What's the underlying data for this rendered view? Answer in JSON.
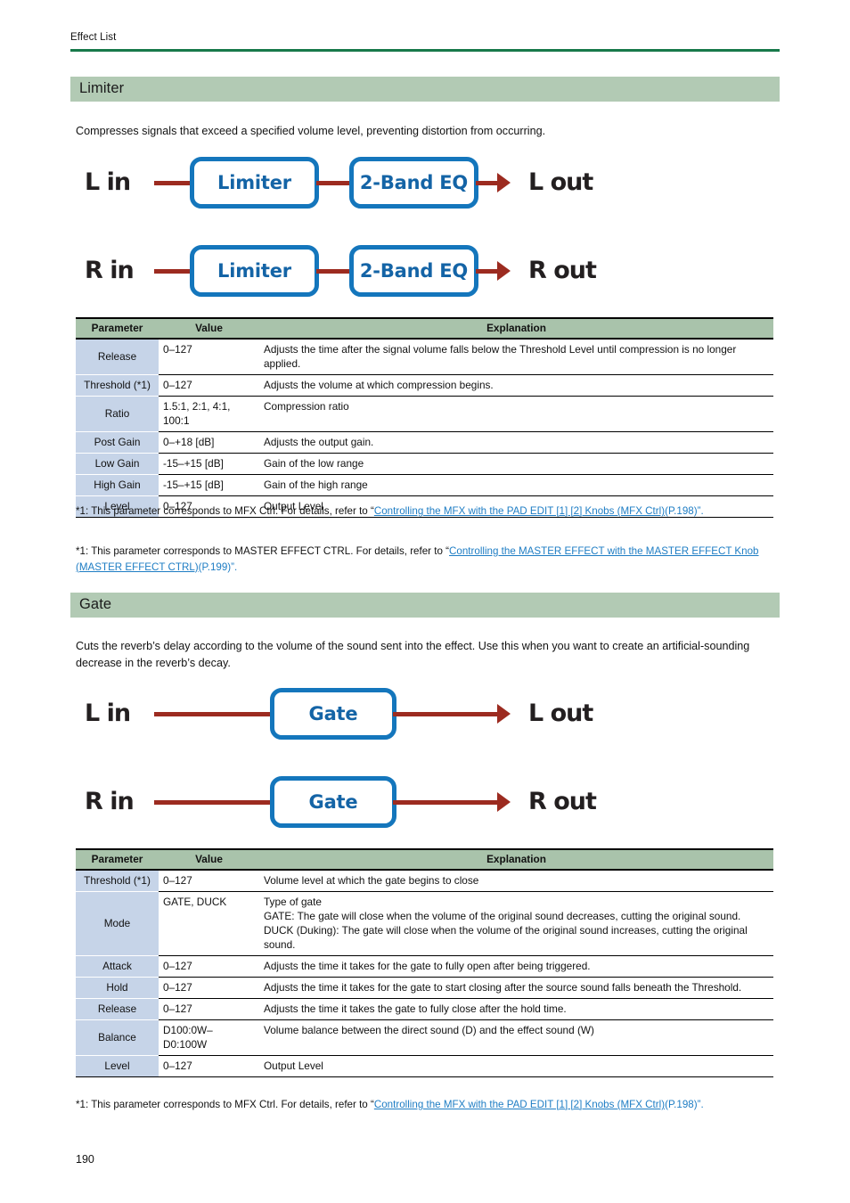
{
  "header": {
    "running_title": "Effect List",
    "rule_color": "#17794a"
  },
  "page_number": "190",
  "colors": {
    "section_band": "#b2cab4",
    "table_header": "#a9c3ab",
    "param_cell": "#c6d4e8",
    "link": "#1e7dc4",
    "wire": "#9c2b20",
    "box_border": "#1476bc",
    "box_text": "#1464a6"
  },
  "sections": [
    {
      "title": "Limiter",
      "description": "Compresses signals that exceed a specified volume level, preventing distortion from occurring.",
      "diagram": {
        "rows": [
          {
            "input_label": "L in",
            "output_label": "L out",
            "blocks": [
              "Limiter",
              "2-Band EQ"
            ]
          },
          {
            "input_label": "R in",
            "output_label": "R out",
            "blocks": [
              "Limiter",
              "2-Band EQ"
            ]
          }
        ]
      },
      "table": {
        "columns": [
          "Parameter",
          "Value",
          "Explanation"
        ],
        "rows": [
          {
            "parameter": "Release",
            "value": "0–127",
            "explanation": "Adjusts the time after the signal volume falls below the Threshold Level until compression is no longer applied."
          },
          {
            "parameter": "Threshold (*1)",
            "value": "0–127",
            "explanation": "Adjusts the volume at which compression begins."
          },
          {
            "parameter": "Ratio",
            "value": "1.5:1, 2:1, 4:1, 100:1",
            "explanation": "Compression ratio"
          },
          {
            "parameter": "Post Gain",
            "value": "0–+18 [dB]",
            "explanation": "Adjusts the output gain."
          },
          {
            "parameter": "Low Gain",
            "value": "-15–+15 [dB]",
            "explanation": "Gain of the low range"
          },
          {
            "parameter": "High Gain",
            "value": "-15–+15 [dB]",
            "explanation": "Gain of the high range"
          },
          {
            "parameter": "Level",
            "value": "0–127",
            "explanation": "Output Level"
          }
        ]
      },
      "footnotes": [
        {
          "prefix": "*1: This parameter corresponds to MFX Ctrl. For details, refer to “",
          "link": "Controlling the MFX with the PAD EDIT [1] [2] Knobs (MFX Ctrl)",
          "suffix": "(P.198)”."
        },
        {
          "prefix": "*1: This parameter corresponds to MASTER EFFECT CTRL. For details, refer to “",
          "link": "Controlling the MASTER EFFECT with the MASTER EFFECT Knob (MASTER EFFECT CTRL)",
          "suffix": "(P.199)”."
        }
      ]
    },
    {
      "title": "Gate",
      "description": "Cuts the reverb’s delay according to the volume of the sound sent into the effect. Use this when you want to create an artificial-sounding decrease in the reverb’s decay.",
      "diagram": {
        "rows": [
          {
            "input_label": "L in",
            "output_label": "L out",
            "blocks": [
              "Gate"
            ]
          },
          {
            "input_label": "R in",
            "output_label": "R out",
            "blocks": [
              "Gate"
            ]
          }
        ]
      },
      "table": {
        "columns": [
          "Parameter",
          "Value",
          "Explanation"
        ],
        "rows": [
          {
            "parameter": "Threshold (*1)",
            "value": "0–127",
            "explanation": "Volume level at which the gate begins to close"
          },
          {
            "parameter": "Mode",
            "value": "GATE, DUCK",
            "explanation": "Type of gate\nGATE: The gate will close when the volume of the original sound decreases, cutting the original sound.\nDUCK (Duking): The gate will close when the volume of the original sound increases, cutting the original sound."
          },
          {
            "parameter": "Attack",
            "value": "0–127",
            "explanation": "Adjusts the time it takes for the gate to fully open after being triggered."
          },
          {
            "parameter": "Hold",
            "value": "0–127",
            "explanation": "Adjusts the time it takes for the gate to start closing after the source sound falls beneath the Threshold."
          },
          {
            "parameter": "Release",
            "value": "0–127",
            "explanation": "Adjusts the time it takes the gate to fully close after the hold time."
          },
          {
            "parameter": "Balance",
            "value": "D100:0W–D0:100W",
            "explanation": "Volume balance between the direct sound (D) and the effect sound (W)"
          },
          {
            "parameter": "Level",
            "value": "0–127",
            "explanation": "Output Level"
          }
        ]
      },
      "footnotes": [
        {
          "prefix": "*1: This parameter corresponds to MFX Ctrl. For details, refer to “",
          "link": "Controlling the MFX with the PAD EDIT [1] [2] Knobs (MFX Ctrl)",
          "suffix": "(P.198)”."
        }
      ]
    }
  ]
}
